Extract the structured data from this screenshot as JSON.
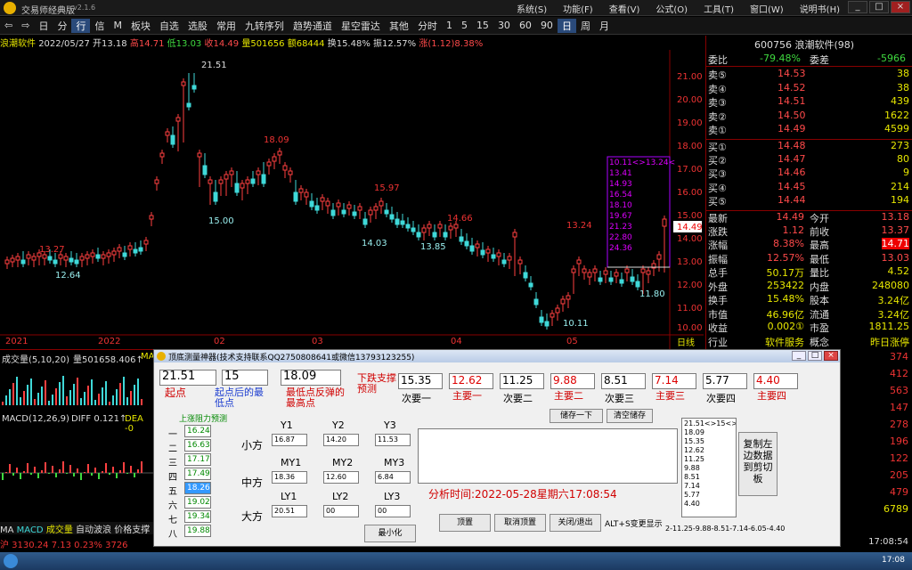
{
  "app": {
    "title": "交易师经典版",
    "version": "v2.1.6"
  },
  "top_menu": [
    "系统(S)",
    "功能(F)",
    "查看(V)",
    "公式(O)",
    "工具(T)",
    "窗口(W)",
    "说明书(H)"
  ],
  "toolbar": [
    "日",
    "分",
    "行",
    "信",
    "M",
    "板块",
    "自选",
    "选股",
    "常用",
    "九转序列",
    "趋势通道",
    "星空雷达",
    "其他",
    "分时",
    "1",
    "5",
    "15",
    "30",
    "60",
    "90",
    "日",
    "周",
    "月"
  ],
  "info_bar": {
    "name": "浪潮软件",
    "date": "2022/05/27",
    "open": "开13.18",
    "high": "高14.71",
    "low": "低13.03",
    "close": "收14.49",
    "vol": "量501656",
    "amt": "额68444",
    "turnover": "换15.48%",
    "amp": "振12.57%",
    "chg": "涨(1.12)8.38%"
  },
  "chart_labels": {
    "peak": "21.51",
    "p1": "18.09",
    "p2": "15.97",
    "p3": "14.66",
    "p4": "13.24",
    "p5": "13.27",
    "l1": "15.00",
    "l2": "14.03",
    "l3": "13.85",
    "l4": "12.64",
    "l5": "10.11",
    "l6": "11.80",
    "price_box": [
      "10.11<>13.24<",
      "13.41",
      "14.93",
      "16.54",
      "18.10",
      "19.67",
      "21.23",
      "22.80",
      "24.36"
    ],
    "cur_price": "14.49"
  },
  "y_axis": [
    "21.00",
    "20.00",
    "19.00",
    "18.00",
    "17.00",
    "16.00",
    "15.00",
    "14.00",
    "13.00",
    "12.00",
    "11.00",
    "10.00"
  ],
  "x_axis": [
    "2021",
    "2022",
    "02",
    "03",
    "04",
    "05",
    "日线"
  ],
  "quote": {
    "code": "600756 浪潮软件(98)",
    "weibi": {
      "l": "委比",
      "v": "-79.48%",
      "l2": "委差",
      "v2": "-5966"
    },
    "asks": [
      [
        "卖⑤",
        "14.53",
        "38"
      ],
      [
        "卖④",
        "14.52",
        "38"
      ],
      [
        "卖③",
        "14.51",
        "439"
      ],
      [
        "卖②",
        "14.50",
        "1622"
      ],
      [
        "卖①",
        "14.49",
        "4599"
      ]
    ],
    "bids": [
      [
        "买①",
        "14.48",
        "273"
      ],
      [
        "买②",
        "14.47",
        "80"
      ],
      [
        "买③",
        "14.46",
        "9"
      ],
      [
        "买④",
        "14.45",
        "214"
      ],
      [
        "买⑤",
        "14.44",
        "194"
      ]
    ],
    "stats": [
      [
        "最新",
        "14.49",
        "今开",
        "13.18"
      ],
      [
        "涨跌",
        "1.12",
        "前收",
        "13.37"
      ],
      [
        "涨幅",
        "8.38%",
        "最高",
        "14.71"
      ],
      [
        "振幅",
        "12.57%",
        "最低",
        "13.03"
      ],
      [
        "总手",
        "50.17万",
        "量比",
        "4.52"
      ],
      [
        "外盘",
        "253422",
        "内盘",
        "248080"
      ],
      [
        "换手",
        "15.48%",
        "股本",
        "3.24亿"
      ],
      [
        "市值",
        "46.96亿",
        "流通",
        "3.24亿"
      ],
      [
        "收益",
        "0.002①",
        "市盈",
        "1811.25"
      ],
      [
        "行业",
        "软件服务",
        "概念",
        "昨日涨停"
      ]
    ],
    "side_nums": [
      "374",
      "412",
      "563",
      "147",
      "278",
      "196",
      "122",
      "205",
      "479",
      "6789"
    ]
  },
  "indicators": {
    "vol": "成交量(5,10,20)",
    "vol_val": "量501658.406↑",
    "ma": "MA",
    "macd": "MACD(12,26,9)",
    "diff": "DIFF 0.121↑",
    "dea": "DEA -0"
  },
  "dialog": {
    "title": "顶底测量神器(技术支持联系QQ2750808641或微信13793123255)",
    "top_inputs": [
      "21.51",
      "15",
      "18.09"
    ],
    "top_labels": [
      "起点",
      "起点后的最低点",
      "最低点反弹的最高点",
      "下跌支撑预测"
    ],
    "targets": [
      [
        "15.35",
        "次要一"
      ],
      [
        "12.62",
        "主要一"
      ],
      [
        "11.25",
        "次要二"
      ],
      [
        "9.88",
        "主要二"
      ],
      [
        "8.51",
        "次要三"
      ],
      [
        "7.14",
        "主要三"
      ],
      [
        "5.77",
        "次要四"
      ],
      [
        "4.40",
        "主要四"
      ]
    ],
    "pressure_title": "上涨阻力预测",
    "pressure_rows": [
      [
        "一",
        "16.24"
      ],
      [
        "二",
        "16.63"
      ],
      [
        "三",
        "17.17"
      ],
      [
        "四",
        "17.49"
      ],
      [
        "五",
        "18.26"
      ],
      [
        "六",
        "19.02"
      ],
      [
        "七",
        "19.34"
      ],
      [
        "八",
        "19.88"
      ]
    ],
    "y_headers": [
      "Y1",
      "Y2",
      "Y3"
    ],
    "small_label": "小方",
    "small": [
      "16.87",
      "14.20",
      "11.53"
    ],
    "my_headers": [
      "MY1",
      "MY2",
      "MY3"
    ],
    "mid_label": "中方",
    "mid": [
      "18.36",
      "12.60",
      "6.84"
    ],
    "ly_headers": [
      "LY1",
      "LY2",
      "LY3"
    ],
    "big_label": "大方",
    "big": [
      "20.51",
      "00",
      "00"
    ],
    "save_btn": "储存一下",
    "clear_btn": "清空储存",
    "analysis_time": "分析时间:2022-05-28星期六17:08:54",
    "list": [
      "21.51<>15<>",
      "18.09",
      "15.35",
      "12.62",
      "11.25",
      "9.88",
      "8.51",
      "7.14",
      "5.77",
      "4.40"
    ],
    "copy_btn": "复制左边数据到剪切板",
    "btns": [
      "最小化",
      "顶置",
      "取消顶置",
      "关闭/退出",
      "ALT+S变更显示"
    ],
    "bottom_text": "2-11.25-9.88-8.51-7.14-6.05-4.40"
  },
  "bottom": {
    "tabs": [
      "MA",
      "MACD",
      "成交量",
      "自动波浪",
      "价格支撑"
    ],
    "index": "沪 3130.24 7.13 0.23% 3726",
    "time": "17:08:54",
    "clock": "17:08"
  }
}
